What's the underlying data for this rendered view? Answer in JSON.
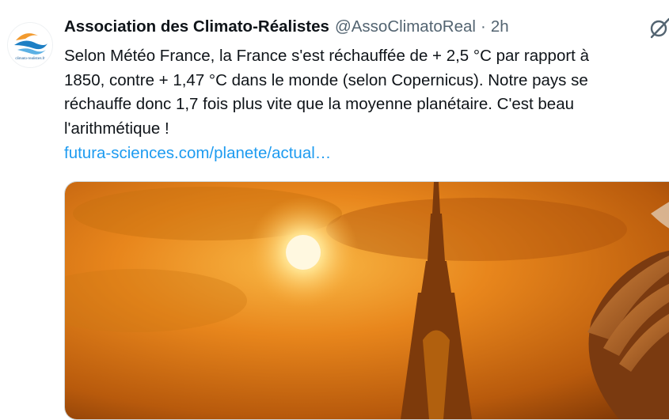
{
  "tweet": {
    "author_name": "Association des Climato-Réalistes",
    "handle": "@AssoClimatoReal",
    "separator": "·",
    "time": "2h",
    "avatar_caption": "climato-realistes.fr",
    "text_lines": [
      "Selon Météo France, la France s'est réchauffée de + 2,5 °C par rapport à",
      "1850, contre + 1,47 °C dans le monde (selon Copernicus). Notre pays se",
      "réchauffe donc 1,7 fois plus vite que la moyenne planétaire. C'est beau",
      "l'arithmétique !"
    ],
    "link_text": "futura-sciences.com/planete/actual…",
    "icons": {
      "avatar": "climato-realistes-logo",
      "action": "grok-slash-icon"
    },
    "colors": {
      "text": "#0f1419",
      "secondary": "#536471",
      "link": "#1d9bf0"
    }
  }
}
